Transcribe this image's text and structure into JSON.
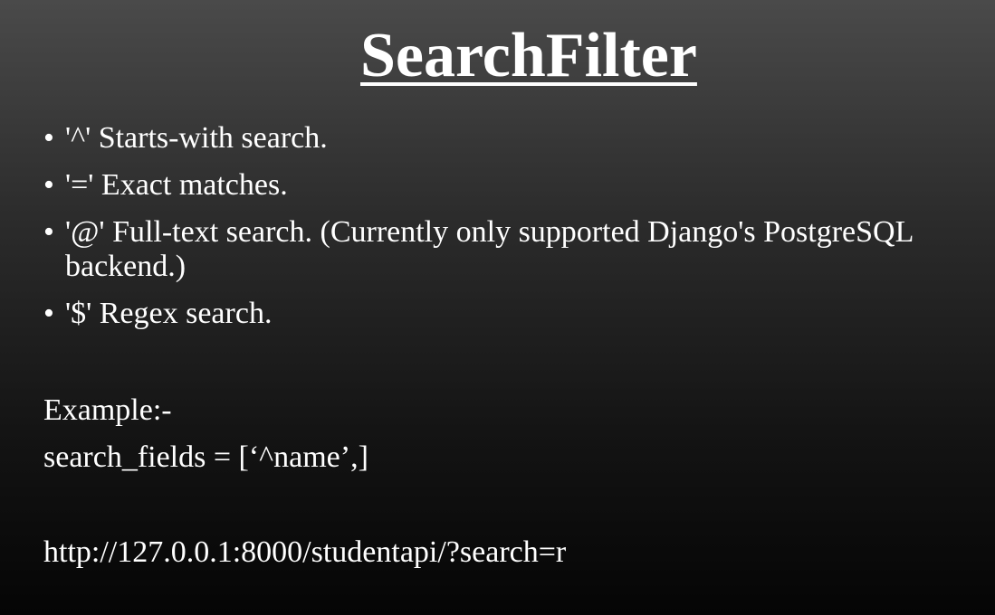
{
  "slide": {
    "title": "SearchFilter",
    "bullets": [
      "'^' Starts-with search.",
      "'=' Exact matches.",
      "'@' Full-text search. (Currently only supported Django's PostgreSQL backend.)",
      "'$' Regex search."
    ],
    "bullet_glyph": "•",
    "example_label": "Example:-",
    "example_code": "search_fields = [‘^name’,]",
    "url": "http://127.0.0.1:8000/studentapi/?search=r"
  }
}
